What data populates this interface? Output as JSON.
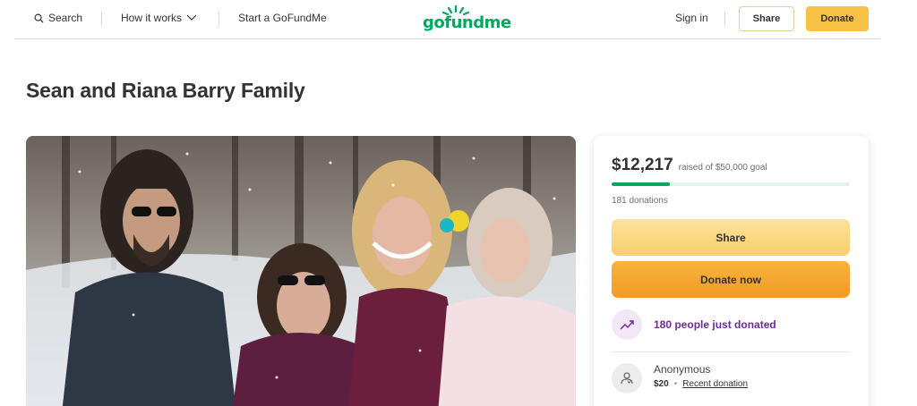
{
  "header": {
    "search_label": "Search",
    "how_it_works_label": "How it works",
    "start_label": "Start a GoFundMe",
    "logo_text": "gofundme",
    "signin_label": "Sign in",
    "share_label": "Share",
    "donate_label": "Donate"
  },
  "campaign": {
    "title": "Sean and Riana Barry Family",
    "photo_alt": "family photo"
  },
  "progress": {
    "raised": "$12,217",
    "goal_text": "raised of $50,000 goal",
    "fraction": 0.244,
    "donations_count": "181 donations"
  },
  "actions": {
    "share_label": "Share",
    "donate_label": "Donate now"
  },
  "activity": {
    "trending_text": "180 people just donated"
  },
  "recent_donation": {
    "name": "Anonymous",
    "amount": "$20",
    "label": "Recent donation"
  },
  "colors": {
    "brand_green": "#02a95c",
    "donate_yellow": "#f7c246",
    "trend_purple": "#6e2b9a"
  },
  "icons": {
    "search": "search-icon",
    "chevron": "chevron-down-icon",
    "trending": "trending-up-icon",
    "donor": "heart-hand-icon"
  }
}
